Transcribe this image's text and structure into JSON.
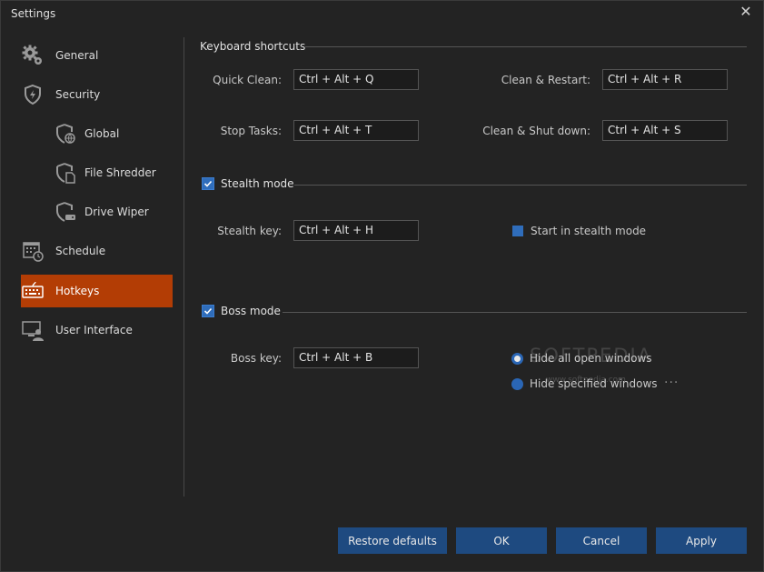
{
  "window": {
    "title": "Settings",
    "close_glyph": "✕"
  },
  "sidebar": {
    "items": [
      {
        "label": "General",
        "icon": "gear-icon"
      },
      {
        "label": "Security",
        "icon": "shield-icon"
      },
      {
        "label": "Global",
        "icon": "shield-globe-icon"
      },
      {
        "label": "File Shredder",
        "icon": "shield-file-icon"
      },
      {
        "label": "Drive Wiper",
        "icon": "shield-drive-icon"
      },
      {
        "label": "Schedule",
        "icon": "calendar-icon"
      },
      {
        "label": "Hotkeys",
        "icon": "keyboard-icon",
        "active": true
      },
      {
        "label": "User Interface",
        "icon": "monitor-user-icon"
      }
    ]
  },
  "shortcuts": {
    "header": "Keyboard shortcuts",
    "quick_clean": {
      "label": "Quick Clean:",
      "value": "Ctrl + Alt + Q"
    },
    "clean_restart": {
      "label": "Clean & Restart:",
      "value": "Ctrl + Alt + R"
    },
    "stop_tasks": {
      "label": "Stop Tasks:",
      "value": "Ctrl + Alt + T"
    },
    "clean_shutdown": {
      "label": "Clean & Shut down:",
      "value": "Ctrl + Alt + S"
    }
  },
  "stealth": {
    "header": "Stealth mode",
    "checked": true,
    "key_label": "Stealth key:",
    "key_value": "Ctrl + Alt + H",
    "start_label": "Start in stealth mode"
  },
  "boss": {
    "header": "Boss mode",
    "checked": true,
    "key_label": "Boss key:",
    "key_value": "Ctrl + Alt + B",
    "option_all": "Hide all open windows",
    "option_specified": "Hide specified windows",
    "more_glyph": "···"
  },
  "watermark": {
    "text": "SOFTPEDIA",
    "sub": "www.softpedia.com"
  },
  "buttons": {
    "restore": "Restore defaults",
    "ok": "OK",
    "cancel": "Cancel",
    "apply": "Apply"
  },
  "colors": {
    "accent_active": "#b33d05",
    "button": "#1e4a80",
    "checkbox": "#2f6dbb",
    "background": "#232323"
  }
}
